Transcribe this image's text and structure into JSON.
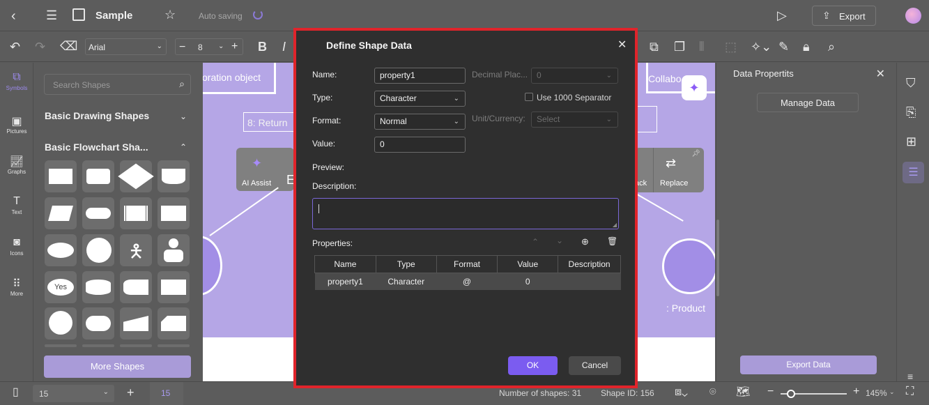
{
  "header": {
    "title": "Sample",
    "auto_saving": "Auto saving",
    "export_label": "Export"
  },
  "toolbar": {
    "font_family": "Arial",
    "font_size": "8"
  },
  "left_rail": {
    "items": [
      {
        "label": "Symbols",
        "icon": "symbols-icon"
      },
      {
        "label": "Pictures",
        "icon": "pictures-icon"
      },
      {
        "label": "Graphs",
        "icon": "graphs-icon"
      },
      {
        "label": "Text",
        "icon": "text-icon"
      },
      {
        "label": "Icons",
        "icon": "icons-icon"
      },
      {
        "label": "More",
        "icon": "more-icon"
      }
    ]
  },
  "shapes_panel": {
    "search_placeholder": "Search Shapes",
    "sections": [
      {
        "title": "Basic Drawing Shapes",
        "expanded": false
      },
      {
        "title": "Basic Flowchart Sha...",
        "expanded": true
      }
    ],
    "yes_tile_label": "Yes",
    "more_shapes": "More Shapes"
  },
  "canvas": {
    "texts": {
      "collab_object": "oration object",
      "return": "8: Return",
      "collab_right": "Collabo",
      "product": ": Product"
    },
    "floating_toolbar": {
      "ai_assist": "AI Assist",
      "back_fragment": "ack",
      "replace": "Replace"
    }
  },
  "dialog": {
    "title": "Define Shape Data",
    "name_label": "Name:",
    "name_value": "property1",
    "type_label": "Type:",
    "type_value": "Character",
    "format_label": "Format:",
    "format_value": "Normal",
    "value_label": "Value:",
    "value_value": "0",
    "decimal_label": "Decimal Plac...",
    "decimal_value": "0",
    "separator_label": "Use 1000 Separator",
    "unit_label": "Unit/Currency:",
    "unit_placeholder": "Select",
    "preview_label": "Preview:",
    "description_label": "Description:",
    "description_value": "",
    "properties_label": "Properties:",
    "table": {
      "headers": [
        "Name",
        "Type",
        "Format",
        "Value",
        "Description"
      ],
      "rows": [
        [
          "property1",
          "Character",
          "@",
          "0",
          ""
        ]
      ]
    },
    "ok": "OK",
    "cancel": "Cancel"
  },
  "right_panel": {
    "title": "Data Propertits",
    "manage_data": "Manage Data",
    "export_data": "Export Data"
  },
  "statusbar": {
    "page_select": "15",
    "page_tab": "15",
    "shape_count": "Number of shapes: 31",
    "shape_id": "Shape ID: 156",
    "zoom": "145%"
  },
  "colors": {
    "accent": "#7b5cf0",
    "canvas_bg": "#b5a6e6",
    "highlight_border": "#e0242b"
  }
}
